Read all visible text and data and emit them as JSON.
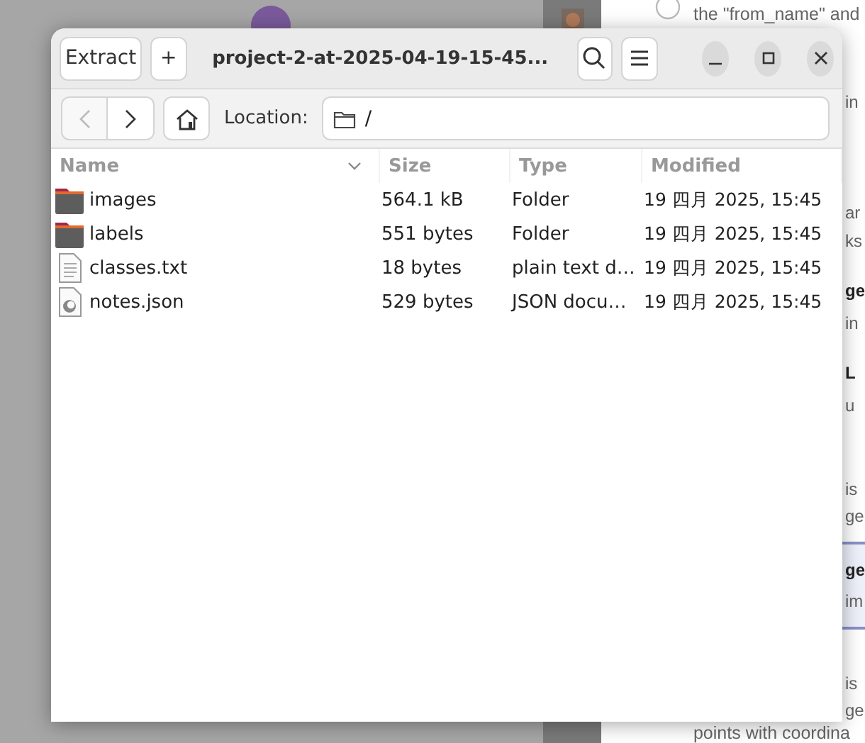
{
  "background": {
    "radio": {
      "checked": false
    },
    "right_lines": [
      {
        "kind": "line",
        "text": "the \"from_name\" and"
      },
      {
        "kind": "fragment",
        "text": "in"
      },
      {
        "kind": "fragment",
        "text": "ar"
      },
      {
        "kind": "fragment",
        "text": "ks"
      },
      {
        "kind": "heading",
        "text": "ge"
      },
      {
        "kind": "fragment",
        "text": "in"
      },
      {
        "kind": "heading",
        "text": "L"
      },
      {
        "kind": "fragment",
        "text": "u"
      },
      {
        "kind": "fragment",
        "text": "is"
      },
      {
        "kind": "fragment",
        "text": "ge"
      },
      {
        "kind": "heading",
        "text": "ge"
      },
      {
        "kind": "fragment",
        "text": "im"
      },
      {
        "kind": "fragment",
        "text": "is"
      },
      {
        "kind": "fragment",
        "text": "ge"
      },
      {
        "kind": "line",
        "text": "points with coordina"
      }
    ]
  },
  "window": {
    "title": "project-2-at-2025-04-19-15-45...",
    "extract_button": "Extract",
    "add_button": "+",
    "location_label": "Location:",
    "location": "/",
    "back_disabled": true,
    "forward_disabled": false
  },
  "table": {
    "columns": [
      "Name",
      "Size",
      "Type",
      "Modified"
    ],
    "rows": [
      {
        "kind": "folder",
        "name": "images",
        "size": "564.1 kB",
        "type": "Folder",
        "modified": "19 四月 2025, 15:45"
      },
      {
        "kind": "folder",
        "name": "labels",
        "size": "551 bytes",
        "type": "Folder",
        "modified": "19 四月 2025, 15:45"
      },
      {
        "kind": "text",
        "name": "classes.txt",
        "size": "18 bytes",
        "type": "plain text d…",
        "modified": "19 四月 2025, 15:45"
      },
      {
        "kind": "json",
        "name": "notes.json",
        "size": "529 bytes",
        "type": "JSON docu…",
        "modified": "19 四月 2025, 15:45"
      }
    ]
  }
}
